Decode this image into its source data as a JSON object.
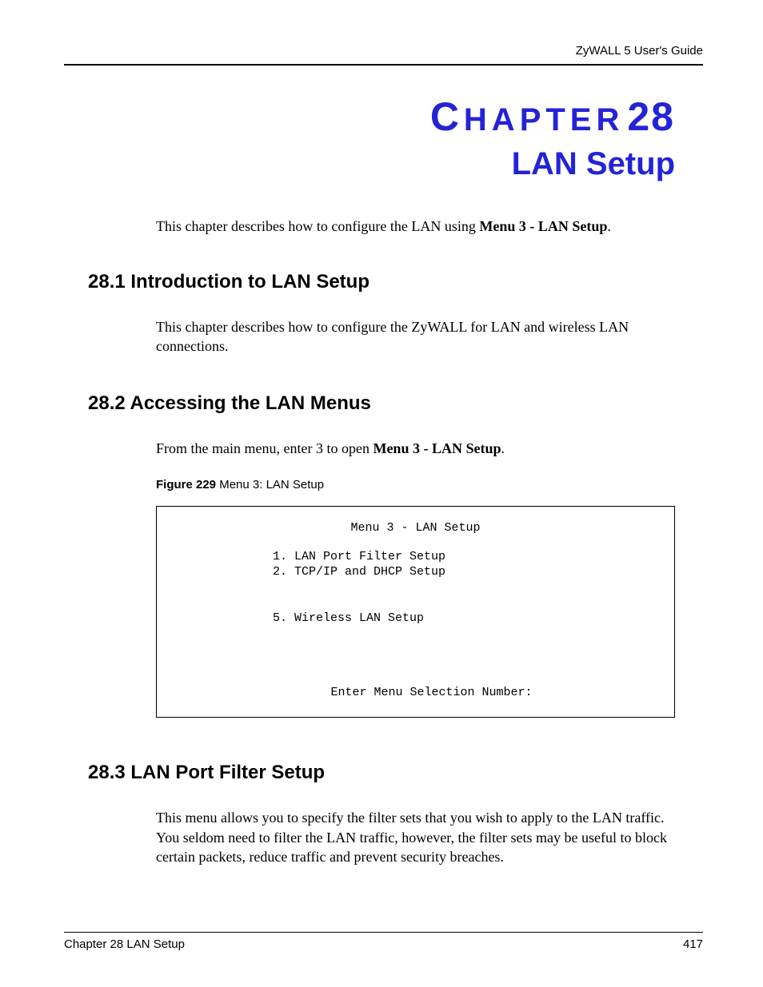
{
  "header": {
    "guide_title": "ZyWALL 5 User's Guide"
  },
  "chapter": {
    "label_small": "C",
    "label_rest": "HAPTER",
    "number": "28",
    "title": "LAN Setup"
  },
  "intro": {
    "text_before": "This chapter describes how to configure the LAN using ",
    "bold": "Menu 3 - LAN Setup",
    "text_after": "."
  },
  "sections": {
    "s1": {
      "heading": "28.1  Introduction to LAN Setup",
      "body": "This chapter describes how to configure the ZyWALL for LAN and wireless LAN connections."
    },
    "s2": {
      "heading": "28.2  Accessing the LAN Menus",
      "body_before": "From the main menu, enter 3 to open ",
      "body_bold": "Menu 3 - LAN Setup",
      "body_after": ".",
      "figure": {
        "label": "Figure 229",
        "caption": "   Menu 3: LAN Setup"
      },
      "menu": {
        "title": "Menu 3 - LAN Setup",
        "item1": "1. LAN Port Filter Setup",
        "item2": "2. TCP/IP and DHCP Setup",
        "item5": "5. Wireless LAN Setup",
        "prompt": "Enter Menu Selection Number:"
      }
    },
    "s3": {
      "heading": "28.3  LAN Port Filter Setup",
      "body": "This menu allows you to specify the filter sets that you wish to apply to the LAN traffic. You seldom need to filter the LAN traffic, however, the filter sets may be useful to block certain packets, reduce traffic and prevent security breaches."
    }
  },
  "footer": {
    "chapter_ref": "Chapter 28 LAN Setup",
    "page_number": "417"
  }
}
